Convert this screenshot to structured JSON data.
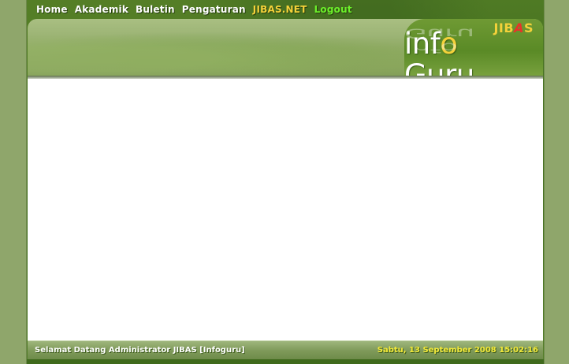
{
  "nav": {
    "home": "Home",
    "akademik": "Akademik",
    "buletin": "Buletin",
    "pengaturan": "Pengaturan",
    "jibas_net": "JIBAS.NET",
    "logout": "Logout"
  },
  "logo": {
    "jibas_prefix": "JIB",
    "jibas_a": "A",
    "jibas_suffix": "S",
    "main_prefix": "inf",
    "main_o": "o",
    "main_suffix": " Guru"
  },
  "footer": {
    "welcome": "Selamat Datang Administrator JIBAS [Infoguru]",
    "datetime": "Sabtu, 13 September 2008 15:02:16"
  },
  "colors": {
    "page_bg": "#8fa66b",
    "nav_link": "#ffffff",
    "jibas_link": "#f5d23a",
    "logout_link": "#6cf02a",
    "footer_date": "#f4ea3a"
  }
}
